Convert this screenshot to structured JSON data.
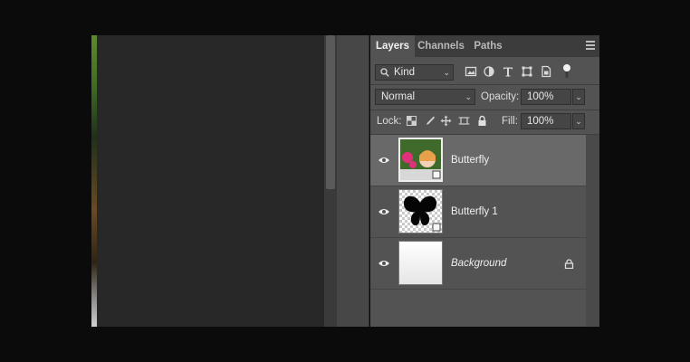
{
  "panel": {
    "tabs": [
      {
        "label": "Layers",
        "active": true
      },
      {
        "label": "Channels",
        "active": false
      },
      {
        "label": "Paths",
        "active": false
      }
    ],
    "filter": {
      "kind_label": "Kind"
    },
    "blend_mode": "Normal",
    "opacity": {
      "label": "Opacity:",
      "value": "100%"
    },
    "lock": {
      "label": "Lock:"
    },
    "fill": {
      "label": "Fill:",
      "value": "100%"
    }
  },
  "layers": [
    {
      "name": "Butterfly",
      "selected": true,
      "visible": true,
      "thumbnail": "photo-smart-object"
    },
    {
      "name": "Butterfly 1",
      "selected": false,
      "visible": true,
      "thumbnail": "butterfly-shape"
    },
    {
      "name": "Background",
      "selected": false,
      "visible": true,
      "locked": true,
      "thumbnail": "white-gradient"
    }
  ],
  "colors": {
    "panel_bg": "#535353",
    "selected_row": "#696969",
    "tab_bar": "#3c3c3c",
    "canvas_bg": "#282828"
  }
}
